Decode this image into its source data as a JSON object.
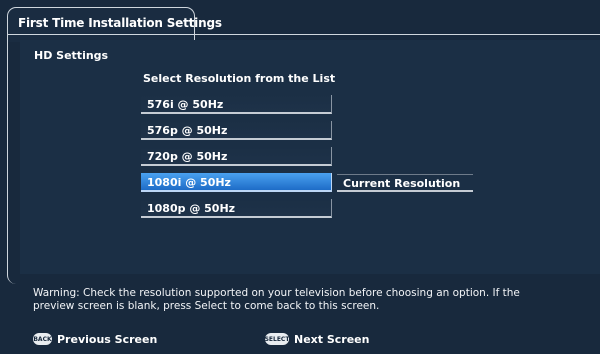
{
  "window": {
    "tab_title": "First Time Installation Settings"
  },
  "section": {
    "title": "HD Settings",
    "list_heading": "Select Resolution from the List"
  },
  "resolutions": [
    {
      "label": "576i @ 50Hz",
      "selected": false
    },
    {
      "label": "576p @ 50Hz",
      "selected": false
    },
    {
      "label": "720p @ 50Hz",
      "selected": false
    },
    {
      "label": "1080i @ 50Hz",
      "selected": true
    },
    {
      "label": "1080p @ 50Hz",
      "selected": false
    }
  ],
  "current_resolution_label": "Current Resolution",
  "warning": "Warning: Check the resolution supported on your television before choosing an option. If the preview screen is blank, press Select to come back to this screen.",
  "footer": {
    "back_icon_text": "BACK",
    "back_label": "Previous Screen",
    "select_icon_text": "SELECT",
    "select_label": "Next Screen"
  },
  "colors": {
    "background": "#18293d",
    "highlight": "#2f86e0",
    "border": "#cfd6dd"
  }
}
